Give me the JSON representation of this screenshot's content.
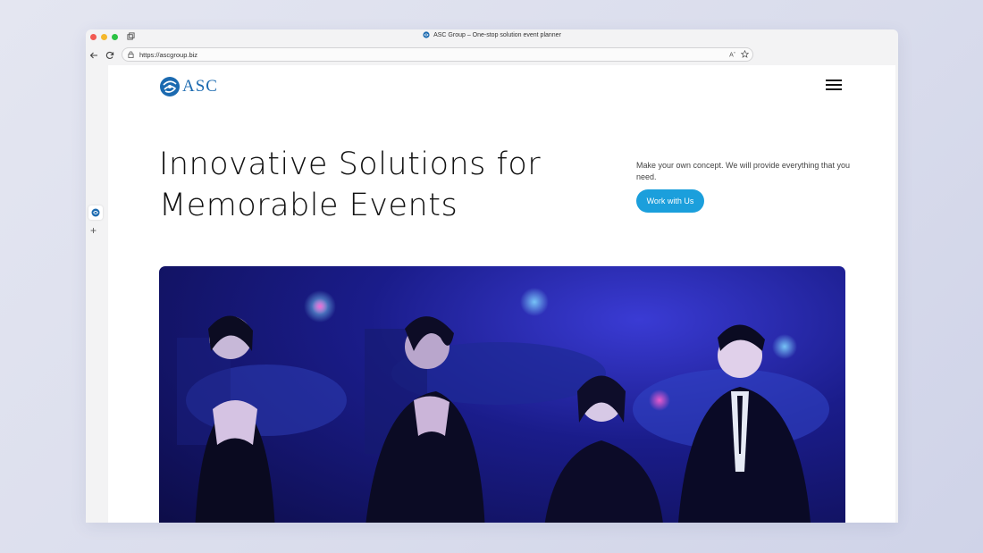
{
  "browser": {
    "tab_title": "ASC Group – One-stop solution event planner",
    "url": "https://ascgroup.biz"
  },
  "header": {
    "logo_text": "ASC",
    "menu_icon": "hamburger-menu-icon"
  },
  "hero": {
    "headline_line1": "Innovative Solutions for",
    "headline_line2": "Memorable Events",
    "intro_text": "Make your own concept. We will provide everything that you need.",
    "cta_label": "Work with Us"
  },
  "colors": {
    "accent": "#1b9fdc",
    "brand": "#1b6ab0"
  }
}
